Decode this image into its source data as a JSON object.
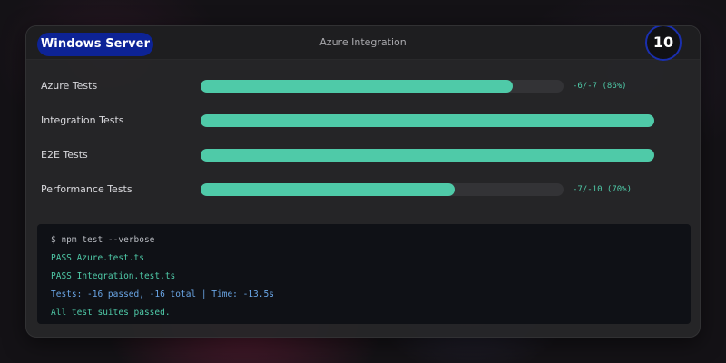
{
  "header": {
    "os_label": "Windows Server",
    "title": "Azure Integration",
    "counter": "10"
  },
  "tests": [
    {
      "label": "Azure Tests",
      "value_text": "-6/-7 (86%)",
      "progress": 0.86
    },
    {
      "label": "Integration Tests",
      "value_text": "",
      "progress": 1.0
    },
    {
      "label": "E2E Tests",
      "value_text": "",
      "progress": 1.0
    },
    {
      "label": "Performance Tests",
      "value_text": "-7/-10 (70%)",
      "progress": 0.7
    }
  ],
  "terminal": {
    "lines": [
      {
        "text": "$ npm test --verbose",
        "color": "#b9bcc2"
      },
      {
        "text": "PASS Azure.test.ts",
        "color": "#4fcaa8"
      },
      {
        "text": "PASS Integration.test.ts",
        "color": "#4fcaa8"
      },
      {
        "text": "Tests: -16 passed, -16 total | Time: -13.5s",
        "color": "#6aa6e6"
      },
      {
        "text": "All test suites passed.",
        "color": "#4fcaa8"
      }
    ]
  },
  "colors": {
    "accent": "#4fcaa8",
    "os_pill": "#0d2396",
    "counter_ring": "#1a2fae"
  }
}
